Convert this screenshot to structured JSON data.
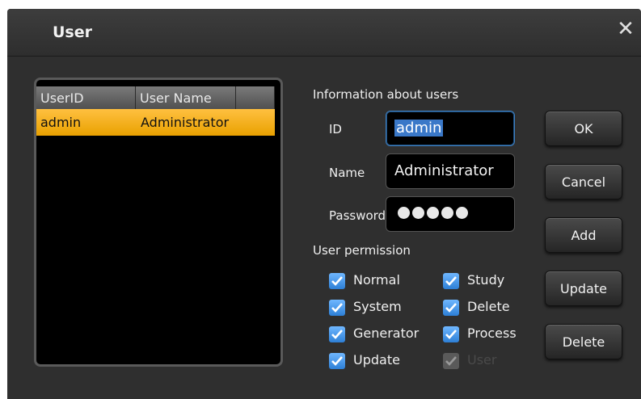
{
  "dialog": {
    "title": "User",
    "close_glyph": "✕"
  },
  "user_list": {
    "columns": [
      "UserID",
      "User Name",
      ""
    ],
    "rows": [
      {
        "id": "admin",
        "name": "Administrator",
        "selected": true
      }
    ]
  },
  "info": {
    "section_label": "Information about users",
    "id_label": "ID",
    "id_value": "admin",
    "name_label": "Name",
    "name_value": "Administrator",
    "password_label": "Password",
    "password_mask_count": 5
  },
  "permissions": {
    "section_label": "User permission",
    "items": [
      {
        "label": "Normal",
        "checked": true,
        "enabled": true
      },
      {
        "label": "Study",
        "checked": true,
        "enabled": true
      },
      {
        "label": "System",
        "checked": true,
        "enabled": true
      },
      {
        "label": "Delete",
        "checked": true,
        "enabled": true
      },
      {
        "label": "Generator",
        "checked": true,
        "enabled": true
      },
      {
        "label": "Process",
        "checked": true,
        "enabled": true
      },
      {
        "label": "Update",
        "checked": true,
        "enabled": true
      },
      {
        "label": "User",
        "checked": true,
        "enabled": false
      }
    ]
  },
  "buttons": {
    "ok": "OK",
    "cancel": "Cancel",
    "add": "Add",
    "update": "Update",
    "delete": "Delete"
  },
  "colors": {
    "selection": "#f0a800",
    "checkbox": "#3a8ee6",
    "focus_border": "#3f7fbf"
  }
}
